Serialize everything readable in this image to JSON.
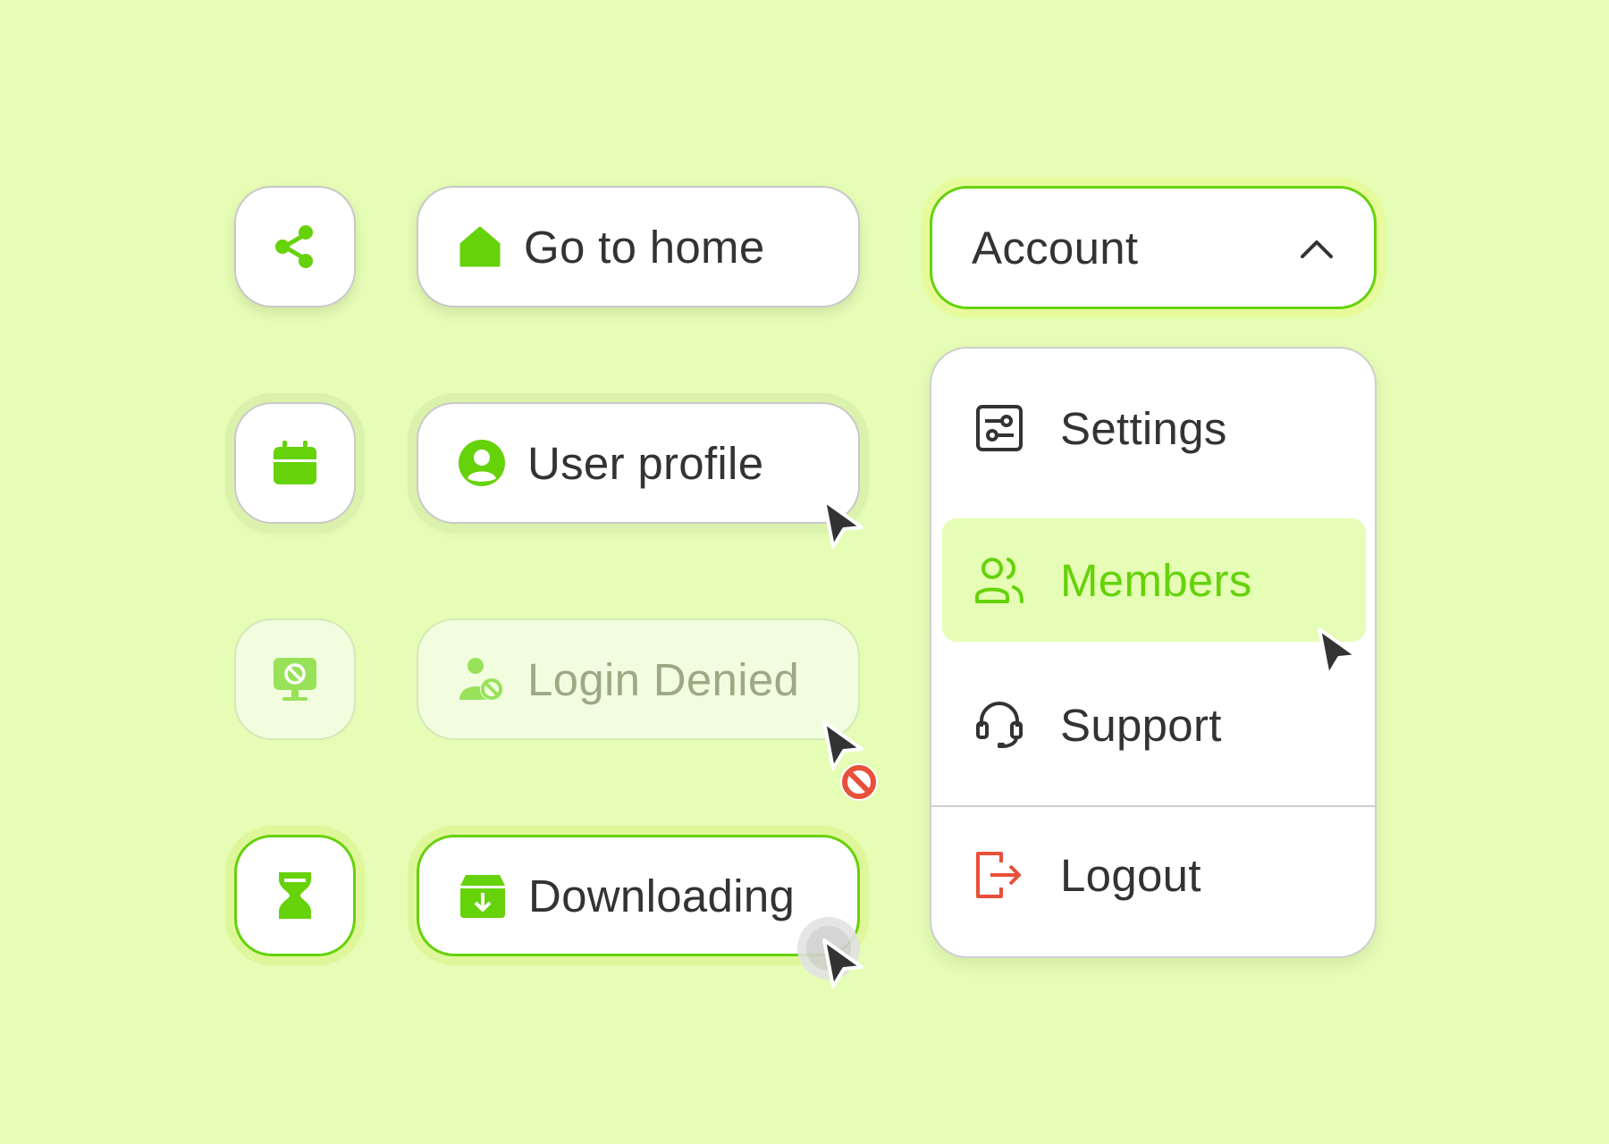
{
  "buttons": {
    "home": "Go to home",
    "profile": "User profile",
    "login_denied": "Login Denied",
    "downloading": "Downloading"
  },
  "account": {
    "label": "Account",
    "menu": [
      {
        "label": "Settings",
        "icon": "settings-sliders-icon"
      },
      {
        "label": "Members",
        "icon": "members-icon",
        "active": true
      },
      {
        "label": "Support",
        "icon": "headset-icon"
      },
      {
        "label": "Logout",
        "icon": "logout-icon"
      }
    ]
  },
  "colors": {
    "background": "#e5fdb5",
    "accent": "#66d20a",
    "text": "#333333",
    "danger": "#e8503a",
    "disabled_text": "#9aab84"
  }
}
